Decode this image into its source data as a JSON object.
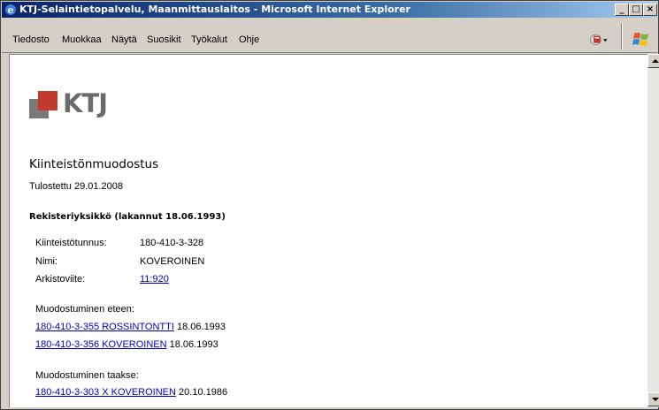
{
  "window": {
    "title": "KTJ-Selaintietopalvelu, Maanmittauslaitos - Microsoft Internet Explorer",
    "buttons": {
      "minimize": "_",
      "maximize": "□",
      "close": "×"
    }
  },
  "menu": {
    "items": [
      {
        "label": "Tiedosto"
      },
      {
        "label": "Muokkaa"
      },
      {
        "label": "Näytä"
      },
      {
        "label": "Suosikit"
      },
      {
        "label": "Työkalut"
      },
      {
        "label": "Ohje"
      }
    ]
  },
  "logo": {
    "text": "KTJ"
  },
  "page": {
    "title": "Kiinteistönmuodostus",
    "printed": "Tulostettu 29.01.2008",
    "unit_heading": "Rekisteriyksikkö (lakannut 18.06.1993)",
    "fields": [
      {
        "label": "Kiinteistötunnus:",
        "value": "180-410-3-328",
        "is_link": false
      },
      {
        "label": "Nimi:",
        "value": "KOVEROINEN",
        "is_link": false
      },
      {
        "label": "Arkistoviite:",
        "value": "11:920",
        "is_link": true
      }
    ],
    "forward": {
      "heading": "Muodostuminen eteen:",
      "items": [
        {
          "link": "180-410-3-355 ROSSINTONTTI",
          "date": "18.06.1993"
        },
        {
          "link": "180-410-3-356 KOVEROINEN",
          "date": "18.06.1993"
        }
      ]
    },
    "backward": {
      "heading": "Muodostuminen taakse:",
      "items": [
        {
          "link": "180-410-3-303 X KOVEROINEN",
          "date": "20.10.1986"
        }
      ]
    }
  },
  "colors": {
    "titlebar": "#0a246a",
    "link": "#0000cc",
    "logo_red": "#c0392b",
    "logo_gray": "#7a7a7a"
  },
  "icons": [
    "ie-icon",
    "pdf-translate-icon",
    "windows-flag-icon",
    "scroll-up-icon",
    "scroll-down-icon"
  ]
}
